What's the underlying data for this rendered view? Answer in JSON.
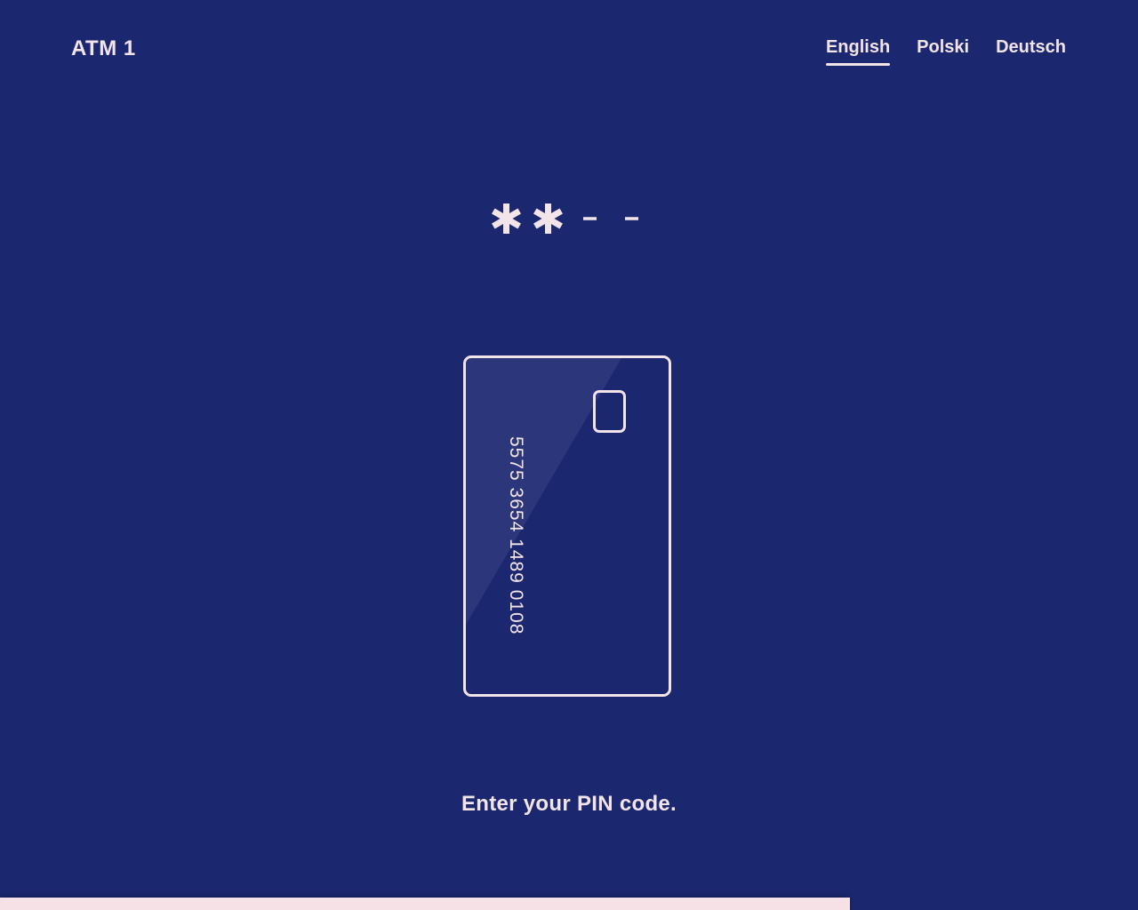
{
  "app": {
    "title": "ATM 1"
  },
  "languages": [
    {
      "label": "English",
      "active": true
    },
    {
      "label": "Polski",
      "active": false
    },
    {
      "label": "Deutsch",
      "active": false
    }
  ],
  "pin": {
    "length": 4,
    "entered": 2,
    "filled_symbol": "asterisk-icon",
    "empty_symbol": "dash-icon"
  },
  "card": {
    "number": "5575 3654 1489 0108"
  },
  "instruction": "Enter your PIN code.",
  "progress": {
    "fraction": 0.747
  },
  "colors": {
    "background": "#1b2870",
    "foreground": "#f3e4ea",
    "progress": "#f5e1e6"
  }
}
